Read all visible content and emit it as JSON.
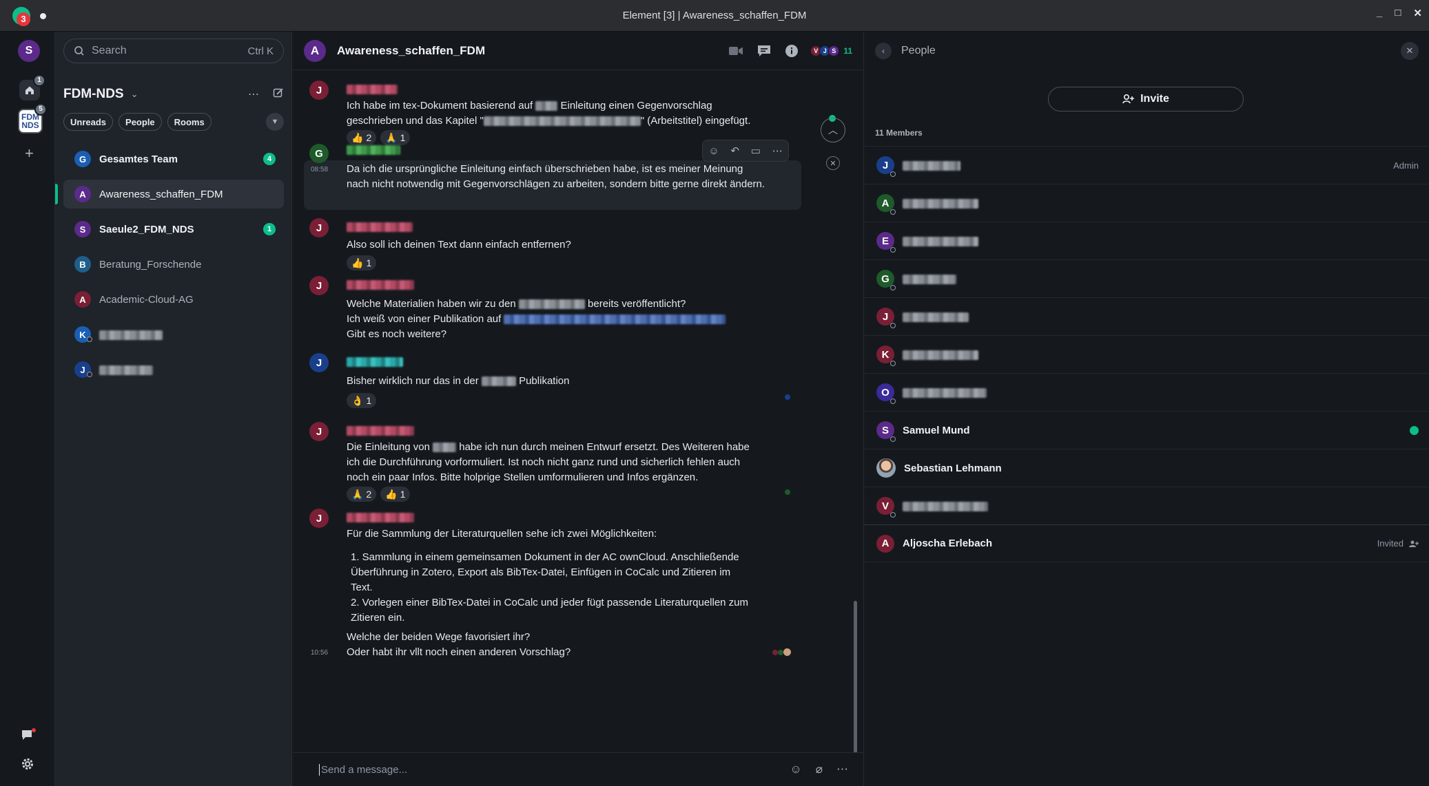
{
  "window": {
    "title": "Element [3] | Awareness_schaffen_FDM",
    "app_badge": "3",
    "controls": [
      "_",
      "□",
      "✕"
    ]
  },
  "spaces_bar": {
    "user_initial": "S",
    "home_badge": "1",
    "fdm_badge": "5",
    "fdm_logo_lines": [
      "FDM",
      "NDS"
    ],
    "add_label": "+"
  },
  "room_list": {
    "search_placeholder": "Search",
    "search_shortcut": "Ctrl K",
    "space_name": "FDM-NDS",
    "filters": [
      "Unreads",
      "People",
      "Rooms"
    ],
    "rooms": [
      {
        "initial": "G",
        "name": "Gesamtes Team",
        "bold": true,
        "unread": "4",
        "color": "#1a5fb4"
      },
      {
        "initial": "A",
        "name": "Awareness_schaffen_FDM",
        "active": true,
        "color": "#5b2a8a"
      },
      {
        "initial": "S",
        "name": "Saeule2_FDM_NDS",
        "bold": true,
        "unread": "1",
        "color": "#5b2a8a"
      },
      {
        "initial": "B",
        "name": "Beratung_Forschende",
        "color": "#1e5f8a"
      },
      {
        "initial": "A",
        "name": "Academic-Cloud-AG",
        "color": "#7a1f35"
      },
      {
        "initial": "K",
        "name": "",
        "dm": true,
        "color": "#1a5fb4"
      },
      {
        "initial": "J",
        "name": "",
        "dm": true,
        "color": "#1a3f8a"
      }
    ]
  },
  "chat": {
    "room_initial": "A",
    "room_name": "Awareness_schaffen_FDM",
    "facepile": [
      "V",
      "J",
      "S"
    ],
    "member_count": "11",
    "messages": [
      {
        "initial": "J",
        "lines": [
          "Ich habe im tex-Dokument basierend auf ",
          " Einleitung einen Gegenvorschlag",
          "geschrieben und das Kapitel \"",
          "\" (Arbeitstitel) eingefügt."
        ],
        "reactions": [
          {
            "emoji": "👍",
            "count": "2"
          },
          {
            "emoji": "🙏",
            "count": "1"
          }
        ]
      },
      {
        "initial": "G",
        "time": "08:58",
        "text": "Da ich die ursprüngliche Einleitung einfach überschrieben habe, ist es meiner Meinung nach nicht notwendig mit Gegenvorschlägen zu arbeiten, sondern bitte gerne direkt ändern."
      },
      {
        "initial": "J",
        "text": "Also soll ich deinen Text dann einfach entfernen?",
        "reactions": [
          {
            "emoji": "👍",
            "count": "1"
          }
        ]
      },
      {
        "initial": "J",
        "lines": [
          "Welche Materialien haben wir zu den ",
          " bereits veröffentlicht?",
          "Ich weiß von einer Publikation auf ",
          "Gibt es noch weitere?"
        ]
      },
      {
        "initial": "J",
        "lines": [
          "Bisher wirklich nur das in der ",
          " Publikation"
        ],
        "reactions": [
          {
            "emoji": "👌",
            "count": "1"
          }
        ]
      },
      {
        "initial": "J",
        "lines": [
          "Die Einleitung von ",
          " habe ich nun durch meinen Entwurf ersetzt. Des Weiteren habe",
          "ich die Durchführung vorformuliert. Ist noch nicht ganz rund und sicherlich fehlen auch",
          "noch ein paar Infos. Bitte holprige Stellen umformulieren und Infos ergänzen."
        ],
        "reactions": [
          {
            "emoji": "🙏",
            "count": "2"
          },
          {
            "emoji": "👍",
            "count": "1"
          }
        ]
      },
      {
        "initial": "J",
        "time": "10:56",
        "intro": "Für die Sammlung der Literaturquellen sehe ich zwei Möglichkeiten:",
        "list": [
          "1. Sammlung in einem gemeinsamen Dokument in der AC ownCloud. Anschließende",
          "Überführung in Zotero, Export als BibTex-Datei, Einfügen in CoCalc und Zitieren im",
          "Text.",
          "2. Vorlegen einer BibTex-Datei in CoCalc und jeder fügt passende Literaturquellen zum",
          "Zitieren ein."
        ],
        "outro": [
          "Welche der beiden Wege favorisiert ihr?",
          "Oder habt ihr vllt noch einen anderen Vorschlag?"
        ]
      }
    ],
    "composer_placeholder": "Send a message..."
  },
  "people_panel": {
    "title": "People",
    "invite_label": "Invite",
    "members_label": "11 Members",
    "members": [
      {
        "initial": "J",
        "name": "",
        "role": "Admin",
        "color": "#1a3f8a"
      },
      {
        "initial": "A",
        "name": "",
        "color": "#1f5a2a"
      },
      {
        "initial": "E",
        "name": "",
        "color": "#5b2a8a"
      },
      {
        "initial": "G",
        "name": "",
        "color": "#1f5a2a"
      },
      {
        "initial": "J",
        "name": "",
        "color": "#7a1f35"
      },
      {
        "initial": "K",
        "name": "",
        "color": "#7a1f35"
      },
      {
        "initial": "O",
        "name": "",
        "color": "#3a2a9a"
      },
      {
        "initial": "S",
        "name": "Samuel Mund",
        "verified": true,
        "color": "#5b2a8a"
      },
      {
        "initial": "",
        "name": "Sebastian Lehmann",
        "photo": true
      },
      {
        "initial": "V",
        "name": "",
        "color": "#7a1f35"
      },
      {
        "initial": "A",
        "name": "Aljoscha Erlebach",
        "role": "Invited",
        "color": "#7a1f35"
      }
    ]
  },
  "colors": {
    "accent": "#0dbd8b",
    "badge_red": "#e5363d"
  }
}
